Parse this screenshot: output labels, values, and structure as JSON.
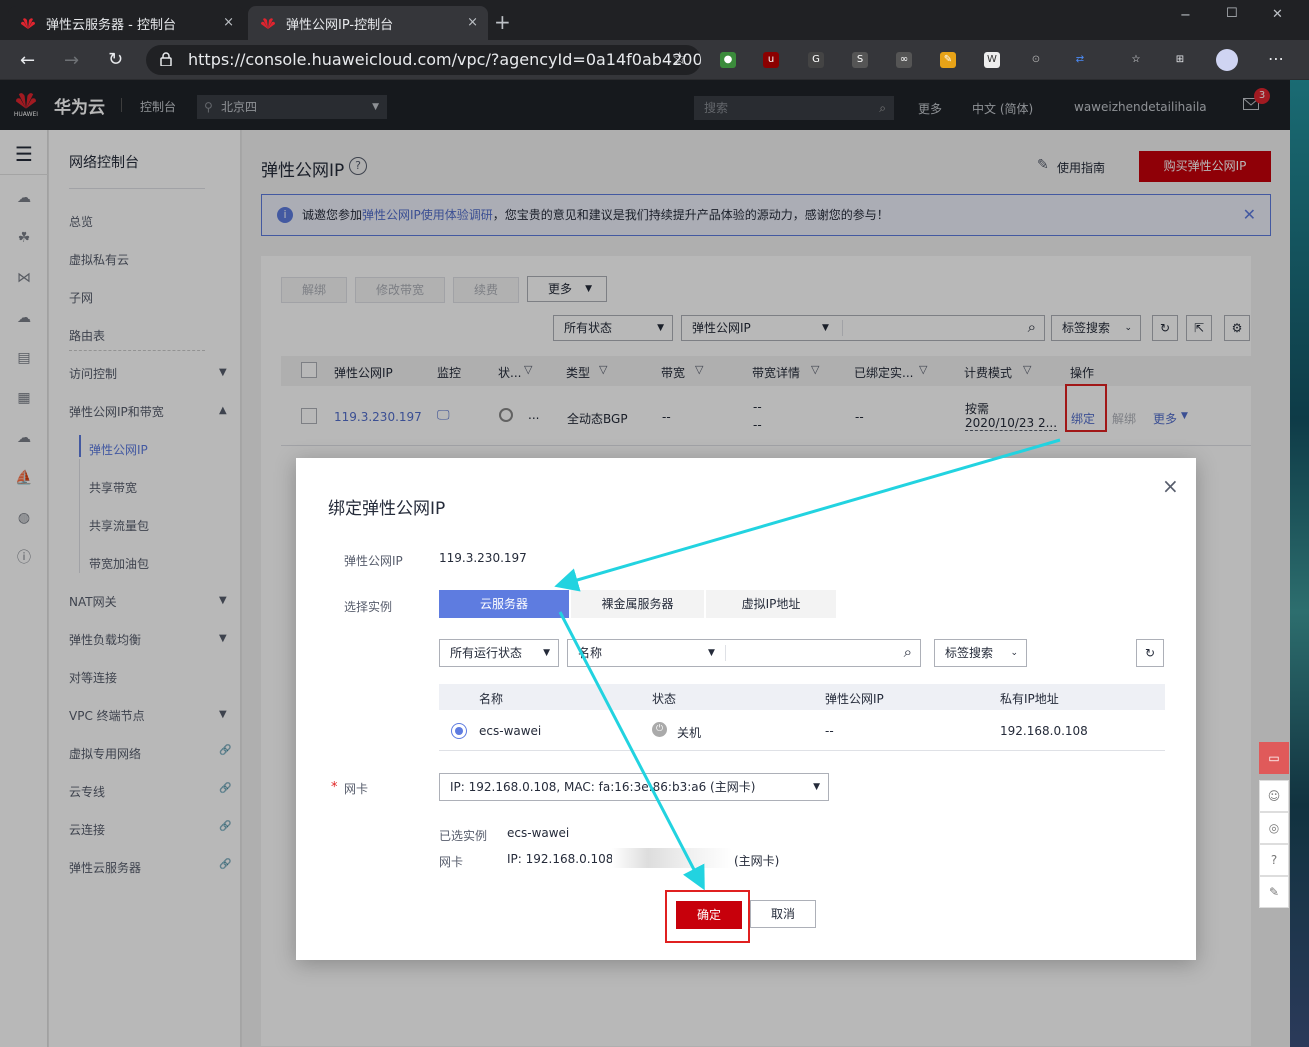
{
  "browser": {
    "tabs": [
      {
        "title": "弹性云服务器 - 控制台",
        "close": "×"
      },
      {
        "title": "弹性公网IP-控制台",
        "close": "×"
      }
    ],
    "new_tab": "+",
    "url": "https://console.huaweicloud.com/vpc/?agencyId=0a14f0ab4200...",
    "window_controls": [
      "−",
      "☐",
      "✕"
    ]
  },
  "header": {
    "logo_caption": "HUAWEI",
    "brand": "华为云",
    "console": "控制台",
    "region": "北京四",
    "search_placeholder": "搜索",
    "more": "更多",
    "language": "中文 (简体)",
    "user": "waweizhendetailihaila",
    "mail_badge": "3"
  },
  "nav": {
    "title": "网络控制台",
    "items": [
      {
        "label": "总览"
      },
      {
        "label": "虚拟私有云"
      },
      {
        "label": "子网"
      },
      {
        "label": "路由表"
      },
      {
        "label": "访问控制"
      },
      {
        "label": "弹性公网IP和带宽"
      },
      {
        "label": "NAT网关"
      },
      {
        "label": "弹性负载均衡"
      },
      {
        "label": "对等连接"
      },
      {
        "label": "VPC 终端节点"
      },
      {
        "label": "虚拟专用网络"
      },
      {
        "label": "云专线"
      },
      {
        "label": "云连接"
      },
      {
        "label": "弹性云服务器"
      }
    ],
    "sub_items": [
      {
        "label": "弹性公网IP"
      },
      {
        "label": "共享带宽"
      },
      {
        "label": "共享流量包"
      },
      {
        "label": "带宽加油包"
      }
    ]
  },
  "page": {
    "title": "弹性公网IP",
    "guide": "使用指南",
    "buy_button": "购买弹性公网IP",
    "notice_prefix": "诚邀您参加",
    "notice_link": "弹性公网IP使用体验调研",
    "notice_suffix": "，您宝贵的意见和建议是我们持续提升产品体验的源动力，感谢您的参与！"
  },
  "toolbar": {
    "unbind": "解绑",
    "modify_bw": "修改带宽",
    "renew": "续费",
    "more": "更多",
    "status_filter": "所有状态",
    "field_filter": "弹性公网IP",
    "tag_search": "标签搜索"
  },
  "table": {
    "columns": [
      "弹性公网IP",
      "监控",
      "状...",
      "类型",
      "带宽",
      "带宽详情",
      "已绑定实...",
      "计费模式",
      "操作"
    ],
    "rows": [
      {
        "ip": "119.3.230.197",
        "status": "...",
        "type": "全动态BGP",
        "bandwidth": "--",
        "bw_detail_1": "--",
        "bw_detail_2": "--",
        "bound": "--",
        "billing_1": "按需",
        "billing_2": "2020/10/23 2...",
        "op_bind": "绑定",
        "op_unbind": "解绑",
        "op_more": "更多"
      }
    ]
  },
  "dialog": {
    "title": "绑定弹性公网IP",
    "eip_label": "弹性公网IP",
    "eip_value": "119.3.230.197",
    "select_label": "选择实例",
    "tabs": [
      "云服务器",
      "裸金属服务器",
      "虚拟IP地址"
    ],
    "run_status": "所有运行状态",
    "name_filter": "名称",
    "tag_search": "标签搜索",
    "grid_columns": [
      "名称",
      "状态",
      "弹性公网IP",
      "私有IP地址"
    ],
    "grid_rows": [
      {
        "name": "ecs-wawei",
        "status": "关机",
        "eip": "--",
        "private_ip": "192.168.0.108"
      }
    ],
    "nic_label": "网卡",
    "nic_value": "IP: 192.168.0.108, MAC: fa:16:3e:86:b3:a6 (主网卡)",
    "selected_instance_label": "已选实例",
    "selected_instance_value": "ecs-wawei",
    "selected_nic_label": "网卡",
    "selected_nic_prefix": "IP: 192.168.0.108, ",
    "selected_nic_suffix": "(主网卡)",
    "confirm": "确定",
    "cancel": "取消",
    "close": "×"
  },
  "colors": {
    "brand_red": "#c7000b",
    "primary_blue": "#5e7ce0",
    "link_blue": "#526ecc",
    "annotation_red": "#e02020",
    "annotation_arrow": "#22d3e0"
  }
}
